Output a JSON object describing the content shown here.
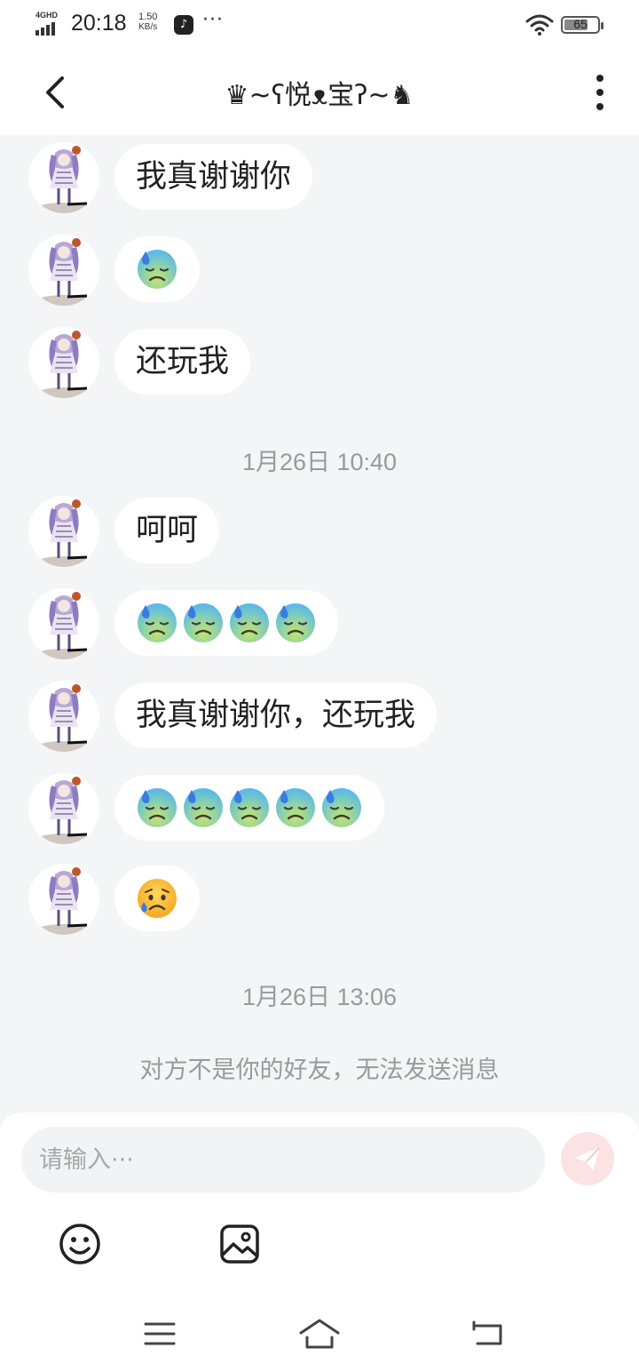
{
  "status_bar": {
    "network": "4GHD",
    "time": "20:18",
    "speed_value": "1.50",
    "speed_unit": "KB/s",
    "more": "···",
    "battery_level": "65"
  },
  "header": {
    "title": "♛~ʕ悦ᴥ宝ʔ~♞",
    "back_icon": "chevron-left-icon",
    "menu_icon": "more-vertical-icon"
  },
  "messages": [
    {
      "type": "text",
      "text": "我真谢谢你"
    },
    {
      "type": "emoji",
      "emoji": "downcast-sweat-face",
      "count": 1
    },
    {
      "type": "text",
      "text": "还玩我"
    },
    {
      "type": "timestamp",
      "text": "1月26日 10:40"
    },
    {
      "type": "text",
      "text": "呵呵"
    },
    {
      "type": "emoji",
      "emoji": "downcast-sweat-face",
      "count": 4
    },
    {
      "type": "text",
      "text": "我真谢谢你，还玩我"
    },
    {
      "type": "emoji",
      "emoji": "downcast-sweat-face",
      "count": 5
    },
    {
      "type": "emoji",
      "emoji": "sad-sweat-face",
      "count": 1
    },
    {
      "type": "timestamp",
      "text": "1月26日 13:06"
    },
    {
      "type": "notice",
      "text": "对方不是你的好友，无法发送消息"
    }
  ],
  "composer": {
    "placeholder": "请输入···",
    "value": "",
    "send_icon": "send-icon",
    "emoji_icon": "smiley-icon",
    "image_icon": "image-icon"
  },
  "nav_bar": {
    "menu_icon": "menu-icon",
    "home_icon": "home-icon",
    "back_icon": "back-icon"
  },
  "colors": {
    "background": "#f4f5f7",
    "bubble": "#ffffff",
    "muted_text": "#9a9a9a",
    "send_button": "#fbe3e3"
  }
}
